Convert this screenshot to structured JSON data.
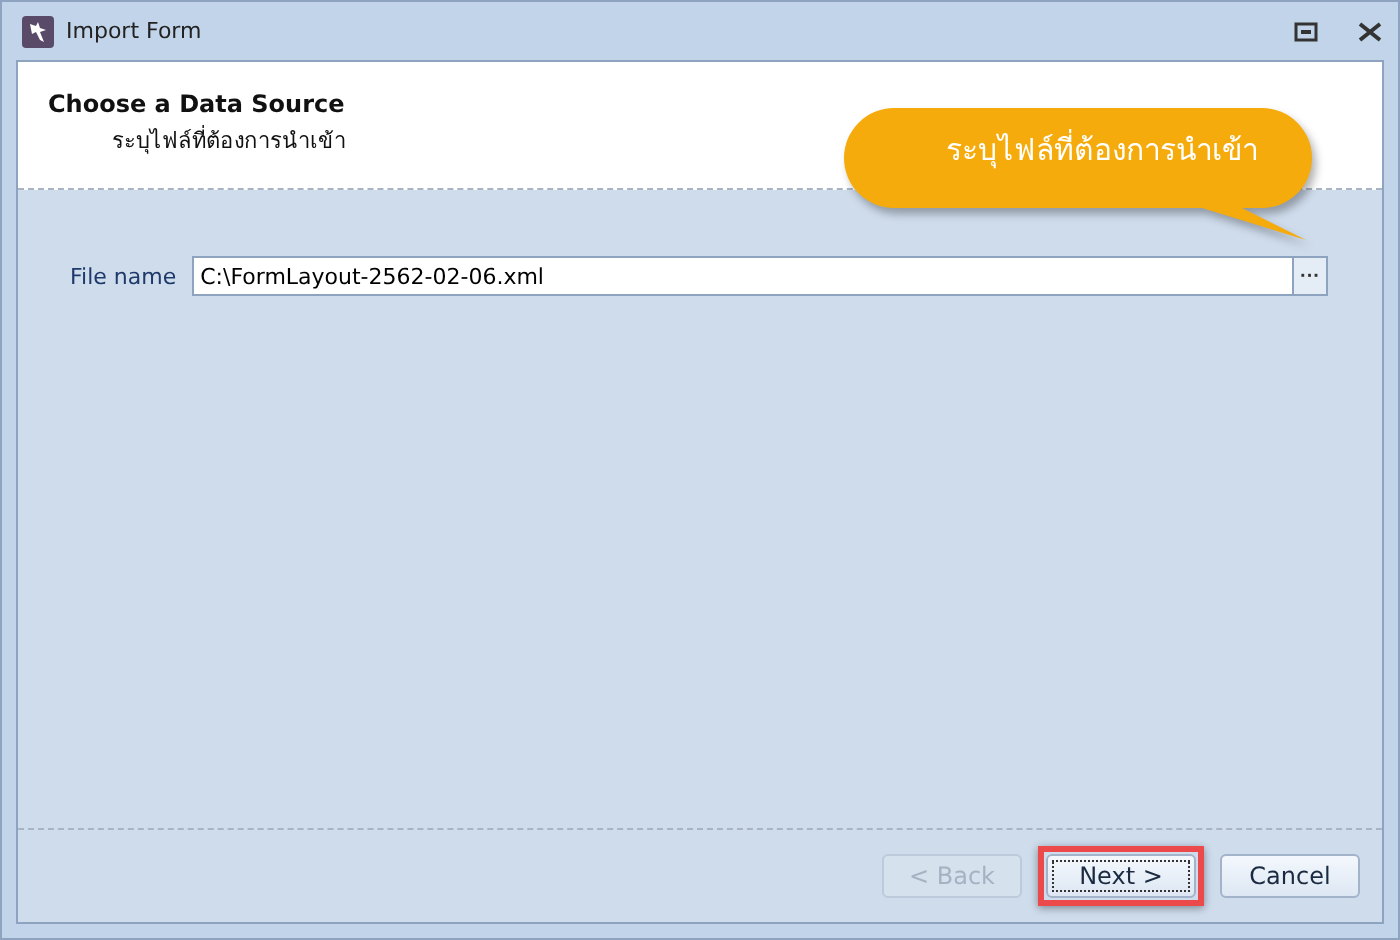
{
  "window": {
    "title": "Import Form"
  },
  "header": {
    "title": "Choose a Data Source",
    "subtitle": "ระบุไฟล์ที่ต้องการนำเข้า"
  },
  "callout": {
    "text": "ระบุไฟล์ที่ต้องการนำเข้า"
  },
  "file_field": {
    "label": "File name",
    "value": "C:\\FormLayout-2562-02-06.xml",
    "browse": "···"
  },
  "buttons": [
    {
      "label": "< Back",
      "disabled": true,
      "highlighted": false
    },
    {
      "label": "Next >",
      "disabled": false,
      "highlighted": true
    },
    {
      "label": "Cancel",
      "disabled": false,
      "highlighted": false
    }
  ]
}
